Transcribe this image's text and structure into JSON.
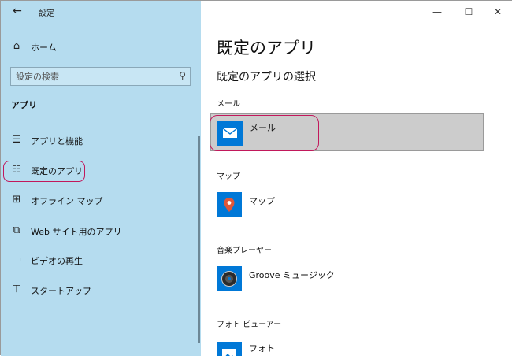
{
  "window": {
    "title": "設定",
    "back_icon": "←",
    "minimize_icon": "—",
    "maximize_icon": "☐",
    "close_icon": "✕"
  },
  "sidebar": {
    "home": {
      "label": "ホーム",
      "icon": "⌂"
    },
    "search": {
      "placeholder": "設定の検索",
      "icon": "⚲"
    },
    "section_header": "アプリ",
    "items": [
      {
        "label": "アプリと機能",
        "icon": "☰"
      },
      {
        "label": "既定のアプリ",
        "icon": "☷",
        "active": true
      },
      {
        "label": "オフライン マップ",
        "icon": "⊞"
      },
      {
        "label": "Web サイト用のアプリ",
        "icon": "⧉"
      },
      {
        "label": "ビデオの再生",
        "icon": "▭"
      },
      {
        "label": "スタートアップ",
        "icon": "⊤"
      }
    ]
  },
  "main": {
    "title": "既定のアプリ",
    "subtitle": "既定のアプリの選択",
    "categories": [
      {
        "label": "メール",
        "app": "メール",
        "icon": "mail-icon",
        "color": "#0078d7",
        "selected": true
      },
      {
        "label": "マップ",
        "app": "マップ",
        "icon": "map-pin-icon",
        "color": "#0078d7"
      },
      {
        "label": "音楽プレーヤー",
        "app": "Groove ミュージック",
        "icon": "groove-music-icon",
        "color": "#0078d7"
      },
      {
        "label": "フォト ビューアー",
        "app": "フォト",
        "icon": "photos-icon",
        "color": "#0078d7"
      }
    ]
  },
  "colors": {
    "sidebar_bg": "#b5dcef",
    "accent": "#0078d7",
    "highlight_ring": "#c2185b",
    "selected_row": "#cccccc"
  }
}
